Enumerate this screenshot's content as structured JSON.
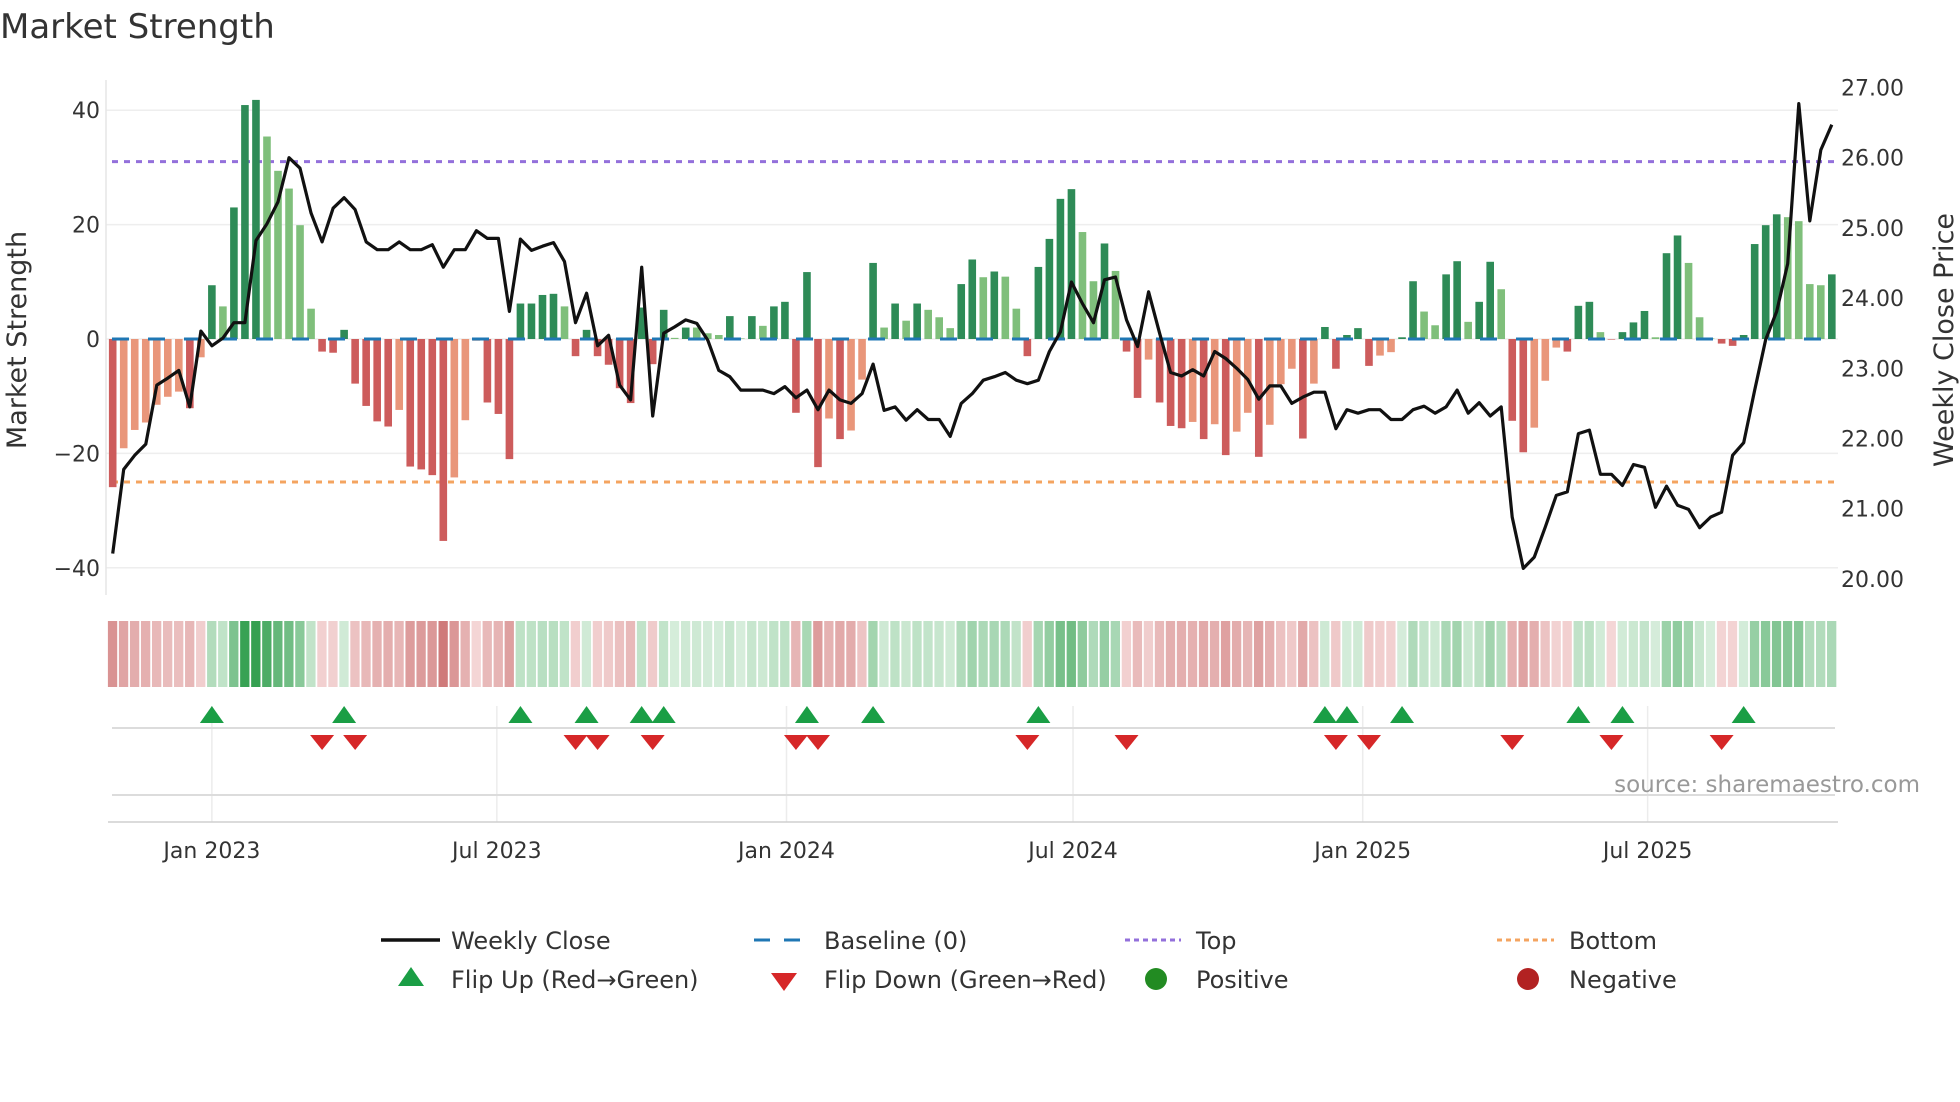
{
  "title": "Market Strength",
  "source": "source: sharemaestro.com",
  "chart_data": {
    "type": "bar",
    "title": "Market Strength",
    "ylabel_left": "Market Strength",
    "ylabel_right": "Weekly Close Price",
    "x_start": "2022-10-30",
    "x_step_days": 7,
    "ylim_left": [
      -44.6,
      45
    ],
    "ylim_right": [
      19.8,
      27.3
    ],
    "yticks_left": [
      {
        "value": 40,
        "label": "40"
      },
      {
        "value": 20,
        "label": "20"
      },
      {
        "value": 0,
        "label": "0"
      },
      {
        "value": -20,
        "label": "−20"
      },
      {
        "value": -40,
        "label": "−40"
      }
    ],
    "yticks_right": [
      {
        "value": 27,
        "label": "27.00"
      },
      {
        "value": 26,
        "label": "26.00"
      },
      {
        "value": 25,
        "label": "25.00"
      },
      {
        "value": 24,
        "label": "24.00"
      },
      {
        "value": 23,
        "label": "23.00"
      },
      {
        "value": 22,
        "label": "22.00"
      },
      {
        "value": 21,
        "label": "21.00"
      },
      {
        "value": 20,
        "label": "20.00"
      }
    ],
    "xticks": [
      {
        "label": "Jan 2023",
        "date": "2023-01-01"
      },
      {
        "label": "Jul 2023",
        "date": "2023-07-01"
      },
      {
        "label": "Jan 2024",
        "date": "2024-01-01"
      },
      {
        "label": "Jul 2024",
        "date": "2024-07-01"
      },
      {
        "label": "Jan 2025",
        "date": "2025-01-01"
      },
      {
        "label": "Jul 2025",
        "date": "2025-07-01"
      }
    ],
    "grid": true,
    "reference_lines": {
      "baseline": 0,
      "top": 31,
      "bottom": -25
    },
    "series": [
      {
        "name": "Market Strength",
        "values": [
          -25.9,
          -19.1,
          -15.9,
          -14.6,
          -11.5,
          -10.1,
          -9.2,
          -12.1,
          -3.2,
          9.4,
          5.7,
          23.0,
          40.9,
          41.8,
          35.4,
          29.4,
          26.3,
          19.9,
          5.3,
          -2.2,
          -2.4,
          1.6,
          -7.8,
          -11.7,
          -14.4,
          -15.3,
          -12.4,
          -22.3,
          -22.8,
          -23.8,
          -35.3,
          -24.2,
          -14.2,
          -0.3,
          -11.1,
          -13.1,
          -21.0,
          6.2,
          6.2,
          7.7,
          7.9,
          5.7,
          -3.0,
          1.6,
          -3.0,
          -4.5,
          -8.6,
          -11.2,
          5.5,
          -4.4,
          5.1,
          0.2,
          2.0,
          2.0,
          1.0,
          0.7,
          4.0,
          0.1,
          4.0,
          2.3,
          5.7,
          6.5,
          -12.9,
          11.7,
          -22.4,
          -13.9,
          -17.5,
          -16.0,
          -7.1,
          13.3,
          2.0,
          6.2,
          3.2,
          6.2,
          5.1,
          3.8,
          1.9,
          9.6,
          13.9,
          10.8,
          11.8,
          10.9,
          5.3,
          -3.0,
          12.6,
          17.5,
          24.5,
          26.2,
          18.7,
          10.1,
          16.7,
          11.9,
          -2.2,
          -10.3,
          -3.6,
          -11.1,
          -15.2,
          -15.6,
          -14.5,
          -17.5,
          -14.9,
          -20.3,
          -16.2,
          -12.9,
          -20.6,
          -15.0,
          -7.9,
          -5.2,
          -17.4,
          -7.8,
          2.1,
          -5.2,
          0.7,
          1.9,
          -4.7,
          -2.9,
          -2.3,
          0.3,
          10.1,
          4.8,
          2.4,
          11.3,
          13.6,
          3.0,
          6.5,
          13.5,
          8.7,
          -14.3,
          -19.8,
          -15.5,
          -7.3,
          -1.5,
          -2.2,
          5.8,
          6.5,
          1.2,
          -0.1,
          1.2,
          2.9,
          4.9,
          0.3,
          15.0,
          18.1,
          13.3,
          3.8,
          0.1,
          -0.8,
          -1.2,
          0.7,
          16.6,
          19.9,
          21.8,
          21.3,
          20.6,
          9.6,
          9.4,
          11.3
        ],
        "shade": [
          "dlllllldld",
          "ldddllllld",
          "ddddddlddd",
          "dllldddddd",
          "dldddddddd",
          "dldllldldl",
          "dddddldlld",
          "ldldlllddl",
          "dlldddddll",
          "dlddldddld",
          "ldlldllldl",
          "dddddllddl",
          "lddlddlddl",
          "lldddldddd",
          "lddllldddd",
          "ddlllld"
        ]
      },
      {
        "name": "Weekly Close",
        "values": [
          20.36,
          21.56,
          21.76,
          21.92,
          22.76,
          22.86,
          22.97,
          22.45,
          23.53,
          23.32,
          23.43,
          23.65,
          23.65,
          24.82,
          25.06,
          25.37,
          26.0,
          25.85,
          25.21,
          24.8,
          25.28,
          25.43,
          25.26,
          24.8,
          24.69,
          24.69,
          24.8,
          24.69,
          24.69,
          24.76,
          24.44,
          24.69,
          24.69,
          24.96,
          24.85,
          24.85,
          23.81,
          24.84,
          24.68,
          24.74,
          24.79,
          24.52,
          23.65,
          24.07,
          23.32,
          23.47,
          22.76,
          22.55,
          24.44,
          22.32,
          23.5,
          23.59,
          23.69,
          23.64,
          23.4,
          22.97,
          22.88,
          22.69,
          22.69,
          22.69,
          22.64,
          22.74,
          22.58,
          22.69,
          22.41,
          22.69,
          22.55,
          22.5,
          22.64,
          23.06,
          22.4,
          22.45,
          22.26,
          22.41,
          22.27,
          22.27,
          22.03,
          22.5,
          22.64,
          22.83,
          22.88,
          22.94,
          22.83,
          22.78,
          22.83,
          23.24,
          23.52,
          24.23,
          23.92,
          23.65,
          24.26,
          24.3,
          23.69,
          23.31,
          24.09,
          23.5,
          22.94,
          22.89,
          22.98,
          22.89,
          23.24,
          23.14,
          23.0,
          22.84,
          22.56,
          22.75,
          22.75,
          22.5,
          22.59,
          22.66,
          22.66,
          22.14,
          22.41,
          22.36,
          22.41,
          22.41,
          22.27,
          22.27,
          22.41,
          22.46,
          22.36,
          22.45,
          22.69,
          22.36,
          22.51,
          22.32,
          22.45,
          20.88,
          20.15,
          20.31,
          20.74,
          21.19,
          21.24,
          22.07,
          22.12,
          21.49,
          21.49,
          21.33,
          21.63,
          21.59,
          21.02,
          21.32,
          21.05,
          20.99,
          20.73,
          20.88,
          20.95,
          21.76,
          21.94,
          22.69,
          23.41,
          23.81,
          24.49,
          26.77,
          25.1,
          26.11,
          26.47
        ]
      }
    ],
    "flip_up_index": [
      9,
      21,
      37,
      43,
      48,
      50,
      63,
      69,
      84,
      110,
      112,
      117,
      133,
      137,
      148
    ],
    "flip_down_index": [
      19,
      22,
      42,
      44,
      49,
      62,
      64,
      83,
      92,
      111,
      114,
      127,
      136,
      146
    ],
    "legend": [
      {
        "label": "Weekly Close",
        "symbol": "line"
      },
      {
        "label": "Baseline (0)",
        "symbol": "dash"
      },
      {
        "label": "Top",
        "symbol": "dotted"
      },
      {
        "label": "Bottom",
        "symbol": "dotted"
      },
      {
        "label": "Flip Up (Red→Green)",
        "symbol": "triangle-up"
      },
      {
        "label": "Flip Down (Green→Red)",
        "symbol": "triangle-down"
      },
      {
        "label": "Positive",
        "symbol": "circle"
      },
      {
        "label": "Negative",
        "symbol": "circle"
      }
    ],
    "colors": {
      "pos_dark": "#2e8b57",
      "pos_light": "#7fbf7b",
      "neg_dark": "#cd5c5c",
      "neg_light": "#e9967a",
      "close": "#111111",
      "baseline": "#1f77b4",
      "top": "#9370db",
      "bottom": "#f4a460",
      "flip_up": "#1a9e45",
      "flip_down": "#d62728",
      "positive": "#228b22",
      "negative": "#b22222"
    }
  }
}
